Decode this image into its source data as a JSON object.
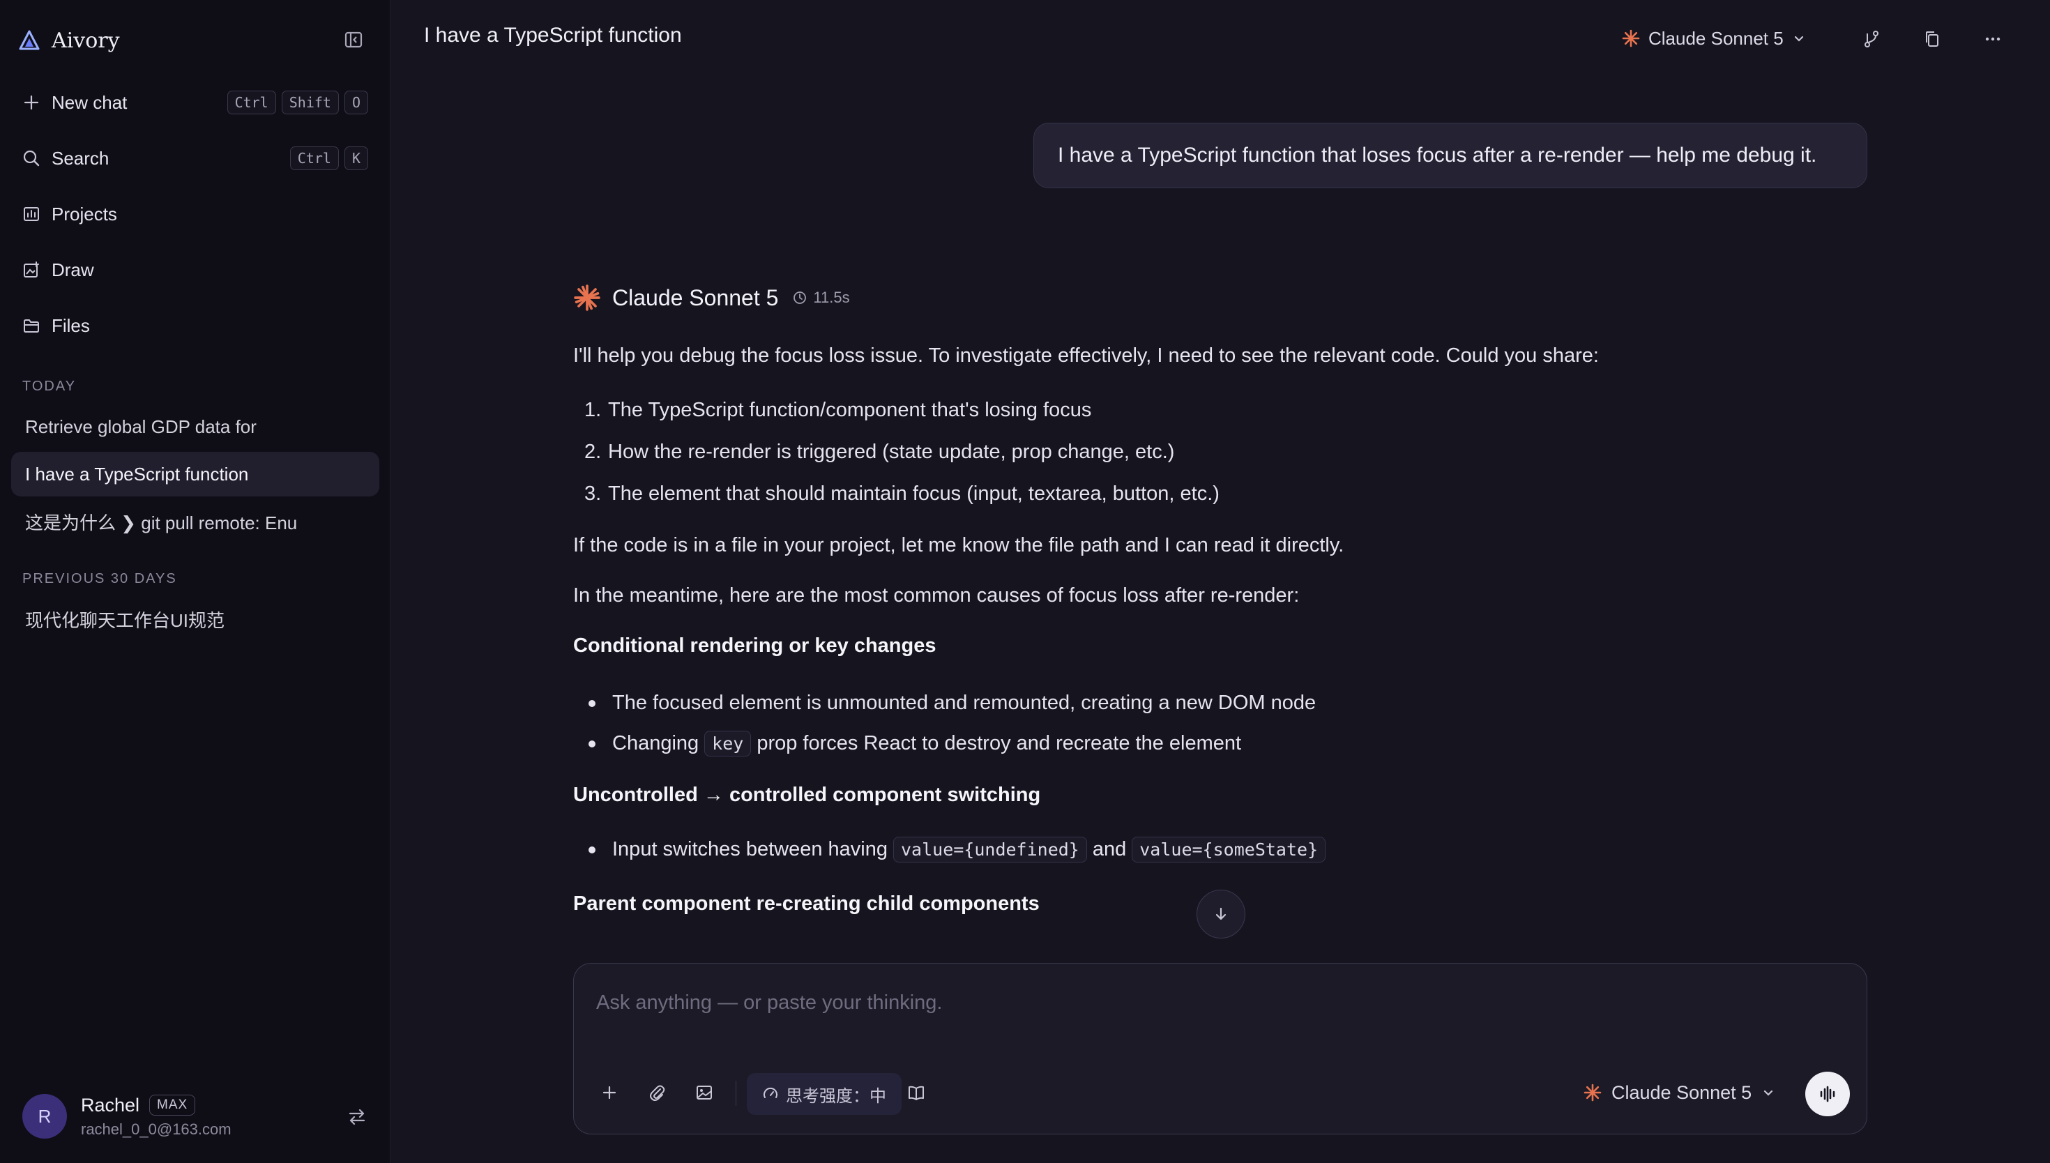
{
  "app": {
    "name": "Aivory"
  },
  "sidebar": {
    "new_chat": {
      "label": "New chat",
      "shortcut": [
        "Ctrl",
        "Shift",
        "O"
      ]
    },
    "search": {
      "label": "Search",
      "shortcut": [
        "Ctrl",
        "K"
      ]
    },
    "projects": {
      "label": "Projects"
    },
    "draw": {
      "label": "Draw"
    },
    "files": {
      "label": "Files"
    },
    "sections": [
      {
        "label": "TODAY",
        "items": [
          "Retrieve global GDP data for",
          "I have a TypeScript function",
          "这是为什么 ❯ git pull remote: Enu"
        ]
      },
      {
        "label": "PREVIOUS 30 DAYS",
        "items": [
          "现代化聊天工作台UI规范"
        ]
      }
    ],
    "active_item": "I have a TypeScript function",
    "user": {
      "initial": "R",
      "name": "Rachel",
      "plan": "MAX",
      "email": "rachel_0_0@163.com"
    }
  },
  "header": {
    "title": "I have a TypeScript function",
    "model": "Claude Sonnet 5"
  },
  "conversation": {
    "user_message": "I have a TypeScript function that loses focus after a re-render — help me debug it.",
    "assistant": {
      "model": "Claude Sonnet 5",
      "elapsed": "11.5s",
      "intro": "I'll help you debug the focus loss issue. To investigate effectively, I need to see the relevant code. Could you share:",
      "requests": [
        "The TypeScript function/component that's losing focus",
        "How the re-render is triggered (state update, prop change, etc.)",
        "The element that should maintain focus (input, textarea, button, etc.)"
      ],
      "file_note": "If the code is in a file in your project, let me know the file path and I can read it directly.",
      "causes_intro": "In the meantime, here are the most common causes of focus loss after re-render:",
      "cause1": {
        "heading": "Conditional rendering or key changes",
        "bullet1": "The focused element is unmounted and remounted, creating a new DOM node",
        "bullet2_pre": "Changing",
        "bullet2_code": "key",
        "bullet2_post": "prop forces React to destroy and recreate the element"
      },
      "cause2": {
        "heading": "Uncontrolled → controlled component switching",
        "bullet1_pre": "Input switches between having",
        "bullet1_code1": "value={undefined}",
        "bullet1_mid": "and",
        "bullet1_code2": "value={someState}"
      },
      "cause3": {
        "heading": "Parent component re-creating child components"
      }
    }
  },
  "composer": {
    "placeholder": "Ask anything — or paste your thinking.",
    "effort_label": "思考强度：中",
    "model": "Claude Sonnet 5"
  },
  "colors": {
    "accent": "#e8734f",
    "background": "#16141f",
    "sidebar": "#0f0e17"
  },
  "icons": [
    "logo-icon",
    "sidebar-toggle-icon",
    "plus-icon",
    "search-icon",
    "projects-icon",
    "draw-icon",
    "folder-icon",
    "spark-icon",
    "chevron-down-icon",
    "branch-icon",
    "copy-icon",
    "more-icon",
    "clock-icon",
    "arrow-down-icon",
    "paperclip-icon",
    "image-icon",
    "gauge-icon",
    "book-icon",
    "waveform-icon",
    "switch-icon"
  ]
}
